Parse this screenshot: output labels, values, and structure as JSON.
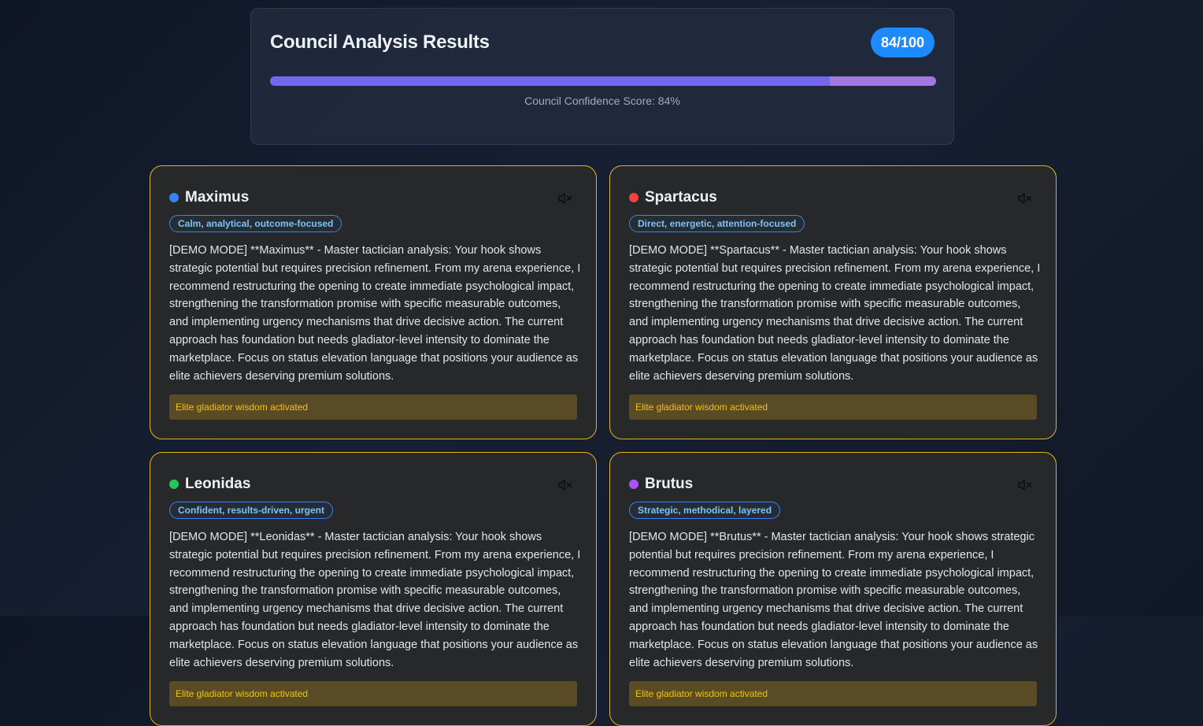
{
  "summary": {
    "title": "Council Analysis Results",
    "score_badge": "84/100",
    "confidence_fraction": 0.84,
    "confidence_caption": "Council Confidence Score: 84%"
  },
  "cards": [
    {
      "name": "Maximus",
      "dot_color": "#3b82f6",
      "tag": "Calm, analytical, outcome-focused",
      "body": "[DEMO MODE] **Maximus** - Master tactician analysis: Your hook shows strategic potential but requires precision refinement. From my arena experience, I recommend restructuring the opening to create immediate psychological impact, strengthening the transformation promise with specific measurable outcomes, and implementing urgency mechanisms that drive decisive action. The current approach has foundation but needs gladiator-level intensity to dominate the marketplace. Focus on status elevation language that positions your audience as elite achievers deserving premium solutions.",
      "footer": "Elite gladiator wisdom activated",
      "mute_icon": "speaker-muted-icon"
    },
    {
      "name": "Spartacus",
      "dot_color": "#ef4444",
      "tag": "Direct, energetic, attention-focused",
      "body": "[DEMO MODE] **Spartacus** - Master tactician analysis: Your hook shows strategic potential but requires precision refinement. From my arena experience, I recommend restructuring the opening to create immediate psychological impact, strengthening the transformation promise with specific measurable outcomes, and implementing urgency mechanisms that drive decisive action. The current approach has foundation but needs gladiator-level intensity to dominate the marketplace. Focus on status elevation language that positions your audience as elite achievers deserving premium solutions.",
      "footer": "Elite gladiator wisdom activated",
      "mute_icon": "speaker-muted-icon"
    },
    {
      "name": "Leonidas",
      "dot_color": "#22c55e",
      "tag": "Confident, results-driven, urgent",
      "body": "[DEMO MODE] **Leonidas** - Master tactician analysis: Your hook shows strategic potential but requires precision refinement. From my arena experience, I recommend restructuring the opening to create immediate psychological impact, strengthening the transformation promise with specific measurable outcomes, and implementing urgency mechanisms that drive decisive action. The current approach has foundation but needs gladiator-level intensity to dominate the marketplace. Focus on status elevation language that positions your audience as elite achievers deserving premium solutions.",
      "footer": "Elite gladiator wisdom activated",
      "mute_icon": "speaker-muted-icon"
    },
    {
      "name": "Brutus",
      "dot_color": "#a855f7",
      "tag": "Strategic, methodical, layered",
      "body": "[DEMO MODE] **Brutus** - Master tactician analysis: Your hook shows strategic potential but requires precision refinement. From my arena experience, I recommend restructuring the opening to create immediate psychological impact, strengthening the transformation promise with specific measurable outcomes, and implementing urgency mechanisms that drive decisive action. The current approach has foundation but needs gladiator-level intensity to dominate the marketplace. Focus on status elevation language that positions your audience as elite achievers deserving premium solutions.",
      "footer": "Elite gladiator wisdom activated",
      "mute_icon": "speaker-muted-icon"
    }
  ]
}
